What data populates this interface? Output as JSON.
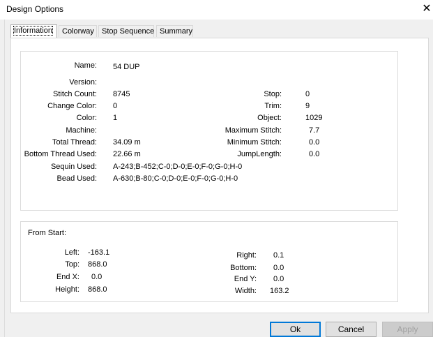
{
  "window": {
    "title": "Design Options",
    "close_glyph": "✕"
  },
  "tabs": [
    "Information",
    "Colorway",
    "Stop Sequence",
    "Summary"
  ],
  "info": {
    "name_label": "Name:",
    "name_value": "54 DUP",
    "version_label": "Version:",
    "version_value": "",
    "stitch_count_label": "Stitch Count:",
    "stitch_count_value": "8745",
    "change_color_label": "Change Color:",
    "change_color_value": "0",
    "color_label": "Color:",
    "color_value": "1",
    "machine_label": "Machine:",
    "machine_value": "",
    "total_thread_label": "Total Thread:",
    "total_thread_value": "34.09 m",
    "bottom_thread_label": "Bottom Thread Used:",
    "bottom_thread_value": "22.66 m",
    "sequin_label": "Sequin Used:",
    "sequin_value": "A-243;B-452;C-0;D-0;E-0;F-0;G-0;H-0",
    "bead_label": "Bead Used:",
    "bead_value": "A-630;B-80;C-0;D-0;E-0;F-0;G-0;H-0",
    "stop_label": "Stop:",
    "stop_value": "0",
    "trim_label": "Trim:",
    "trim_value": "9",
    "object_label": "Object:",
    "object_value": "1029",
    "max_stitch_label": "Maximum Stitch:",
    "max_stitch_value": "7.7",
    "min_stitch_label": "Minimum Stitch:",
    "min_stitch_value": "0.0",
    "jump_label": "JumpLength:",
    "jump_value": "0.0"
  },
  "from_start": {
    "heading": "From Start:",
    "left_label": "Left:",
    "left_value": "-163.1",
    "top_label": "Top:",
    "top_value": "868.0",
    "endx_label": "End X:",
    "endx_value": "0.0",
    "height_label": "Height:",
    "height_value": "868.0",
    "right_label": "Right:",
    "right_value": "0.1",
    "bottom_label": "Bottom:",
    "bottom_value": "0.0",
    "endy_label": "End Y:",
    "endy_value": "0.0",
    "width_label": "Width:",
    "width_value": "163.2"
  },
  "buttons": {
    "ok": "Ok",
    "cancel": "Cancel",
    "apply": "Apply"
  }
}
